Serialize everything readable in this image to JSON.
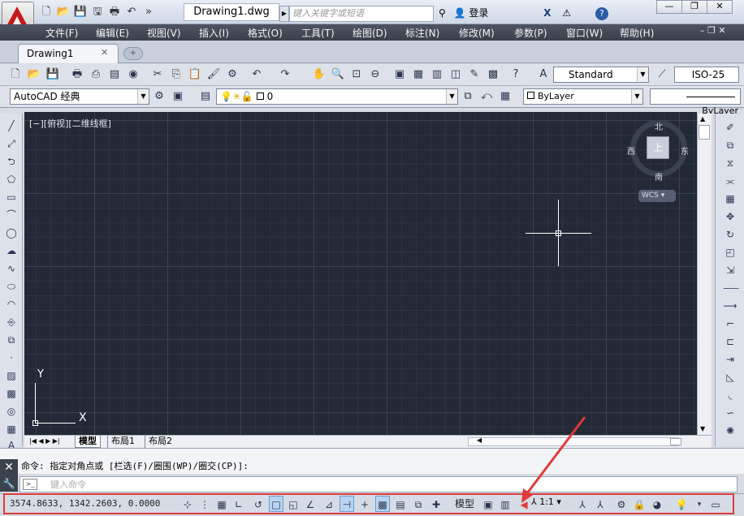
{
  "title_bar": {
    "document_title": "Drawing1.dwg",
    "search_placeholder": "键入关键字或短语",
    "login_label": "登录",
    "help_label": "?",
    "window_controls": [
      "—",
      "❐",
      "✕"
    ]
  },
  "menu_bar": {
    "items": [
      "文件(F)",
      "编辑(E)",
      "视图(V)",
      "插入(I)",
      "格式(O)",
      "工具(T)",
      "绘图(D)",
      "标注(N)",
      "修改(M)",
      "参数(P)",
      "窗口(W)",
      "帮助(H)"
    ]
  },
  "tabs": {
    "active_tab": "Drawing1",
    "close_glyph": "✕"
  },
  "toolbar": {
    "text_style": "Standard",
    "dim_style": "ISO-25",
    "workspace": "AutoCAD 经典",
    "layer": "0",
    "color": "ByLayer",
    "linetype": "ByLayer"
  },
  "viewport": {
    "label": "[−][俯视][二维线框]",
    "compass": {
      "north": "北",
      "south": "南",
      "east": "东",
      "west": "西",
      "center": "上"
    },
    "wcs_label": "WCS",
    "ucs_y": "Y",
    "ucs_x": "X"
  },
  "layout_tabs": [
    "模型",
    "布局1",
    "布局2"
  ],
  "command": {
    "history": "命令: 指定对角点或 [栏选(F)/圈围(WP)/圈交(CP)]:",
    "placeholder": "键入命令"
  },
  "status_bar": {
    "coordinates": "3574.8633, 1342.2603, 0.0000",
    "model_label": "模型",
    "annotation_scale": "1:1",
    "highlight_color": "#e03a3a"
  }
}
